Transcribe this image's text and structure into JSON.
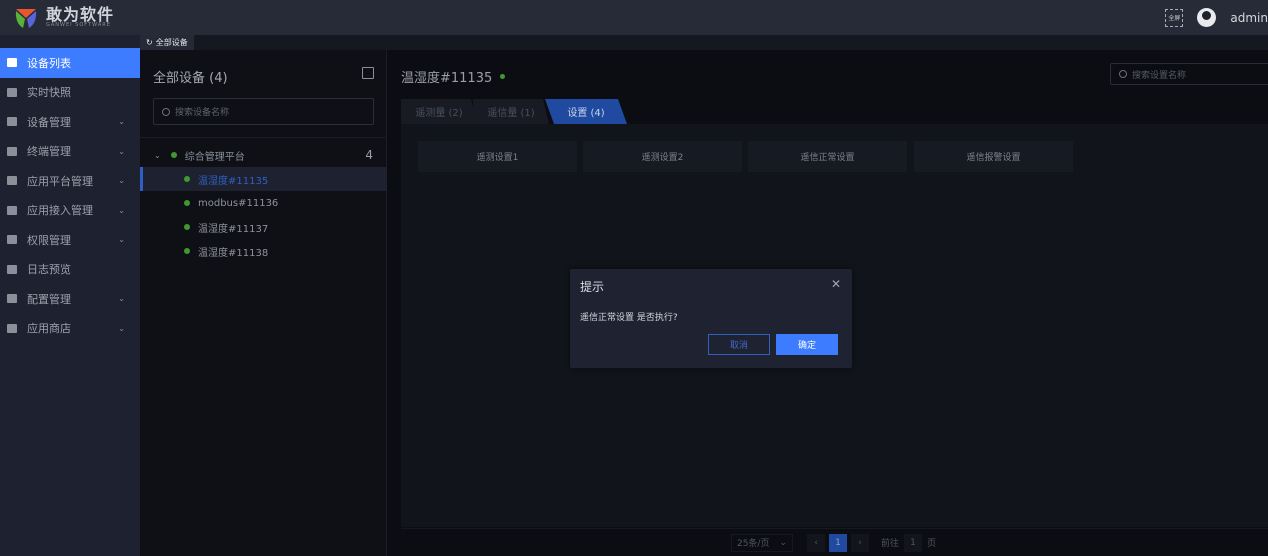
{
  "header": {
    "brand": "敢为软件",
    "brand_en": "GANWEI SOFTWARE",
    "fullscreen_label": "全屏",
    "user": "admin"
  },
  "tab_strip": {
    "tab": "全部设备"
  },
  "sidebar": {
    "items": [
      {
        "label": "设备列表",
        "active": true,
        "expandable": false
      },
      {
        "label": "实时快照",
        "expandable": false
      },
      {
        "label": "设备管理",
        "expandable": true
      },
      {
        "label": "终端管理",
        "expandable": true
      },
      {
        "label": "应用平台管理",
        "expandable": true
      },
      {
        "label": "应用接入管理",
        "expandable": true
      },
      {
        "label": "权限管理",
        "expandable": true
      },
      {
        "label": "日志预览",
        "expandable": false
      },
      {
        "label": "配置管理",
        "expandable": true
      },
      {
        "label": "应用商店",
        "expandable": true
      }
    ]
  },
  "devices": {
    "title": "全部设备 (4)",
    "search_placeholder": "搜索设备名称",
    "root": {
      "label": "综合管理平台",
      "count": "4"
    },
    "nodes": [
      "温湿度#11135",
      "modbus#11136",
      "温湿度#11137",
      "温湿度#11138"
    ]
  },
  "detail": {
    "title": "温湿度#11135",
    "search_placeholder": "搜索设置名称",
    "tabs": [
      "遥测量 (2)",
      "遥信量 (1)",
      "设置 (4)"
    ],
    "settings": [
      "遥测设置1",
      "遥测设置2",
      "遥信正常设置",
      "遥信报警设置"
    ],
    "pager": {
      "page_size": "25条/页",
      "current": "1",
      "goto_label": "前往",
      "goto_value": "1",
      "page_unit": "页"
    }
  },
  "dialog": {
    "title": "提示",
    "message": "遥信正常设置 是否执行?",
    "cancel": "取消",
    "confirm": "确定"
  },
  "colors": {
    "accent": "#3d7cff",
    "online": "#3f9a2e"
  }
}
